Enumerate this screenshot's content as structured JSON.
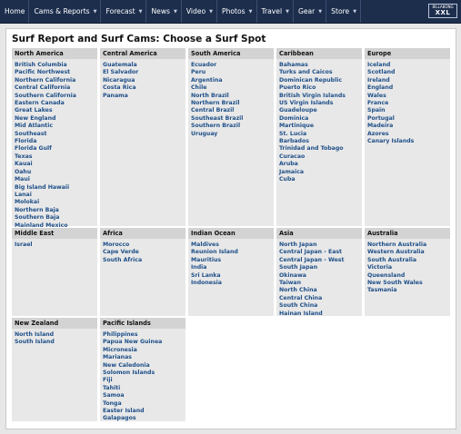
{
  "nav": {
    "items": [
      {
        "label": "Home",
        "dropdown": false
      },
      {
        "label": "Cams & Reports",
        "dropdown": true
      },
      {
        "label": "Forecast",
        "dropdown": true
      },
      {
        "label": "News",
        "dropdown": true
      },
      {
        "label": "Video",
        "dropdown": true
      },
      {
        "label": "Photos",
        "dropdown": true
      },
      {
        "label": "Travel",
        "dropdown": true
      },
      {
        "label": "Gear",
        "dropdown": true
      },
      {
        "label": "Store",
        "dropdown": true
      }
    ],
    "logo_text_top": "BILLABONG",
    "logo_text_big": "XXL"
  },
  "page": {
    "title": "Surf Report and Surf Cams: Choose a Surf Spot"
  },
  "regions": [
    {
      "name": "North America",
      "spots": [
        "British Columbia",
        "Pacific Northwest",
        "Northern California",
        "Central California",
        "Southern California",
        "Eastern Canada",
        "Great Lakes",
        "New England",
        "Mid Atlantic",
        "Southeast",
        "Florida",
        "Florida Gulf",
        "Texas",
        "Kauai",
        "Oahu",
        "Maui",
        "Big Island Hawaii",
        "Lanai",
        "Molokai",
        "Northern Baja",
        "Southern Baja",
        "Mainland Mexico"
      ]
    },
    {
      "name": "Central America",
      "spots": [
        "Guatemala",
        "El Salvador",
        "Nicaragua",
        "Costa Rica",
        "Panama"
      ]
    },
    {
      "name": "South America",
      "spots": [
        "Ecuador",
        "Peru",
        "Argentina",
        "Chile",
        "North Brazil",
        "Northern Brazil",
        "Central Brazil",
        "Southeast Brazil",
        "Southern Brazil",
        "Uruguay"
      ]
    },
    {
      "name": "Caribbean",
      "spots": [
        "Bahamas",
        "Turks and Caicos",
        "Dominican Republic",
        "Puerto Rico",
        "British Virgin Islands",
        "US Virgin Islands",
        "Guadeloupe",
        "Dominica",
        "Martinique",
        "St. Lucia",
        "Barbados",
        "Trinidad and Tobago",
        "Curacao",
        "Aruba",
        "Jamaica",
        "Cuba"
      ]
    },
    {
      "name": "Europe",
      "spots": [
        "Iceland",
        "Scotland",
        "Ireland",
        "England",
        "Wales",
        "France",
        "Spain",
        "Portugal",
        "Madeira",
        "Azores",
        "Canary Islands"
      ]
    },
    {
      "name": "Middle East",
      "spots": [
        "Israel"
      ]
    },
    {
      "name": "Africa",
      "spots": [
        "Morocco",
        "Cape Verde",
        "South Africa"
      ]
    },
    {
      "name": "Indian Ocean",
      "spots": [
        "Maldives",
        "Reunion Island",
        "Mauritius",
        "India",
        "Sri Lanka",
        "Indonesia"
      ]
    },
    {
      "name": "Asia",
      "spots": [
        "North Japan",
        "Central Japan - East",
        "Central Japan - West",
        "South Japan",
        "Okinawa",
        "Taiwan",
        "North China",
        "Central China",
        "South China",
        "Hainan Island"
      ]
    },
    {
      "name": "Australia",
      "spots": [
        "Northern Australia",
        "Western Australia",
        "South Australia",
        "Victoria",
        "Queensland",
        "New South Wales",
        "Tasmania"
      ]
    },
    {
      "name": "New Zealand",
      "spots": [
        "North Island",
        "South Island"
      ]
    },
    {
      "name": "Pacific Islands",
      "spots": [
        "Philippines",
        "Papua New Guinea",
        "Micronesia",
        "Marianas",
        "New Caledonia",
        "Solomon Islands",
        "Fiji",
        "Tahiti",
        "Samoa",
        "Tonga",
        "Easter Island",
        "Galapagos"
      ]
    }
  ]
}
